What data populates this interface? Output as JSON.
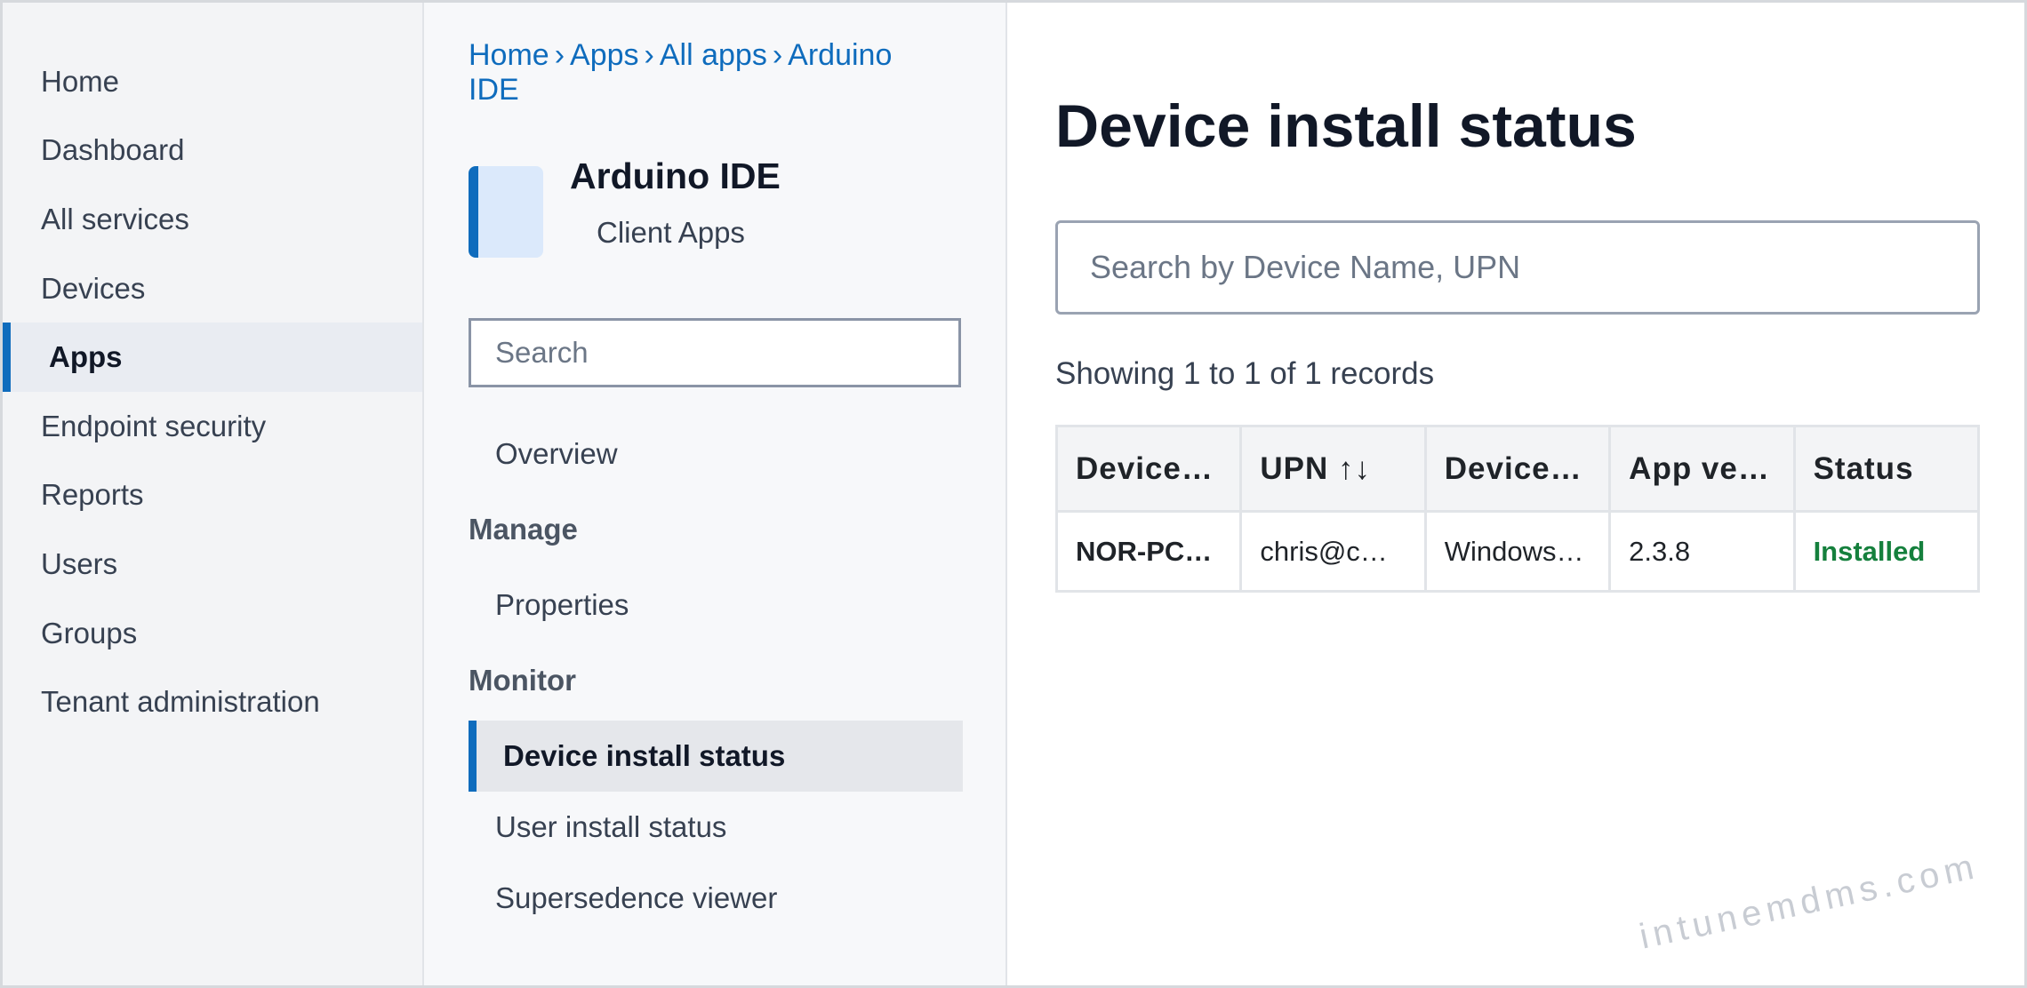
{
  "nav": {
    "items": [
      {
        "label": "Home"
      },
      {
        "label": "Dashboard"
      },
      {
        "label": "All services"
      },
      {
        "label": "Devices"
      },
      {
        "label": "Apps"
      },
      {
        "label": "Endpoint security"
      },
      {
        "label": "Reports"
      },
      {
        "label": "Users"
      },
      {
        "label": "Groups"
      },
      {
        "label": "Tenant administration"
      }
    ],
    "active": "Apps"
  },
  "breadcrumb": [
    "Home",
    "Apps",
    "All apps",
    "Arduino IDE"
  ],
  "breadcrumb_separator": "›",
  "app": {
    "title": "Arduino IDE",
    "subtitle": "Client Apps"
  },
  "blade_search": {
    "placeholder": "Search"
  },
  "menu": {
    "overview": "Overview",
    "manage_section": "Manage",
    "properties": "Properties",
    "monitor_section": "Monitor",
    "device_install_status": "Device install status",
    "user_install_status": "User install status",
    "supersedence_viewer": "Supersedence viewer"
  },
  "main": {
    "title": "Device install status",
    "search_placeholder": "Search by Device Name, UPN",
    "records_text": "Showing 1 to 1 of 1 records",
    "columns": [
      "Device…",
      "UPN ↑↓",
      "Device…",
      "App ve…",
      "Status"
    ],
    "rows": [
      [
        "NOR-PC…",
        "chris@c…",
        "Windows…",
        "2.3.8",
        "Installed"
      ]
    ]
  },
  "watermark": "intunemdms.com",
  "colors": {
    "accent": "#0f6cbd",
    "status_installed": "#15803d"
  }
}
